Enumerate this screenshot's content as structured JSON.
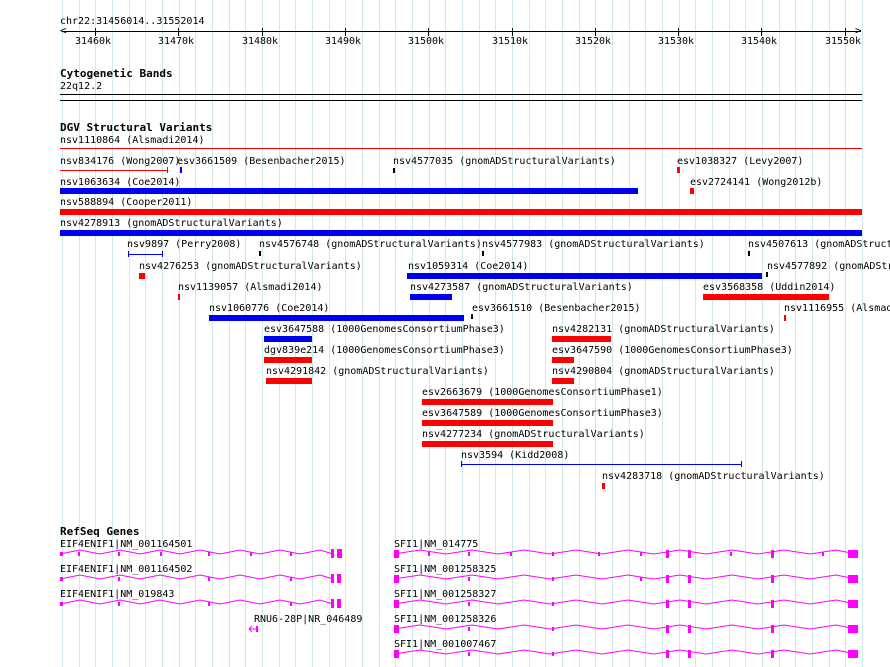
{
  "ruler": {
    "title": "chr22:31456014..31552014",
    "tick_labels": [
      "31460k",
      "31470k",
      "31480k",
      "31490k",
      "31500k",
      "31510k",
      "31520k",
      "31530k",
      "31540k",
      "31550k"
    ]
  },
  "cytoband": {
    "title": "Cytogenetic Bands",
    "band": "22q12.2"
  },
  "dgv": {
    "title": "DGV Structural Variants",
    "subtitle": "nsv1110864 (Alsmadi2014)",
    "colors": {
      "loss": "#ff0000",
      "gain": "#0000ee"
    },
    "labels": [
      "nsv834176 (Wong2007)",
      "esv3661509 (Besenbacher2015)",
      "nsv4577035 (gnomADStructuralVariants)",
      "esv1038327 (Levy2007)",
      "nsv1063634 (Coe2014)",
      "esv2724141 (Wong2012b)",
      "nsv588894 (Cooper2011)",
      "nsv4278913 (gnomADStructuralVariants)",
      "nsv9897 (Perry2008)",
      "nsv4576748 (gnomADStructuralVariants)",
      "nsv4577983 (gnomADStructuralVariants)",
      "nsv4507613 (gnomADStructu",
      "nsv4276253 (gnomADStructuralVariants)",
      "nsv1059314 (Coe2014)",
      "nsv4577892 (gnomADStructu",
      "nsv1139057 (Alsmadi2014)",
      "nsv4273587 (gnomADStructuralVariants)",
      "esv3568358 (Uddin2014)",
      "nsv1060776 (Coe2014)",
      "esv3661510 (Besenbacher2015)",
      "nsv1116955 (Alsmad",
      "esv3647588 (1000GenomesConsortiumPhase3)",
      "nsv4282131 (gnomADStructuralVariants)",
      "dgv839e214 (1000GenomesConsortiumPhase3)",
      "esv3647590 (1000GenomesConsortiumPhase3)",
      "nsv4291842 (gnomADStructuralVariants)",
      "nsv4290804 (gnomADStructuralVariants)",
      "esv2663679 (1000GenomesConsortiumPhase1)",
      "esv3647589 (1000GenomesConsortiumPhase3)",
      "nsv4277234 (gnomADStructuralVariants)",
      "nsv3594 (Kidd2008)",
      "nsv4283718 (gnomADStructuralVariants)"
    ]
  },
  "refseq": {
    "title": "RefSeq Genes",
    "color": "#ff00ff",
    "genes": [
      "EIF4ENIF1|NM_001164501",
      "SFI1|NM_014775",
      "EIF4ENIF1|NM_001164502",
      "SFI1|NM_001258325",
      "EIF4ENIF1|NM_019843",
      "SFI1|NM_001258327",
      "RNU6-28P|NR_046489",
      "SFI1|NM_001258326",
      "SFI1|NM_001007467"
    ]
  }
}
